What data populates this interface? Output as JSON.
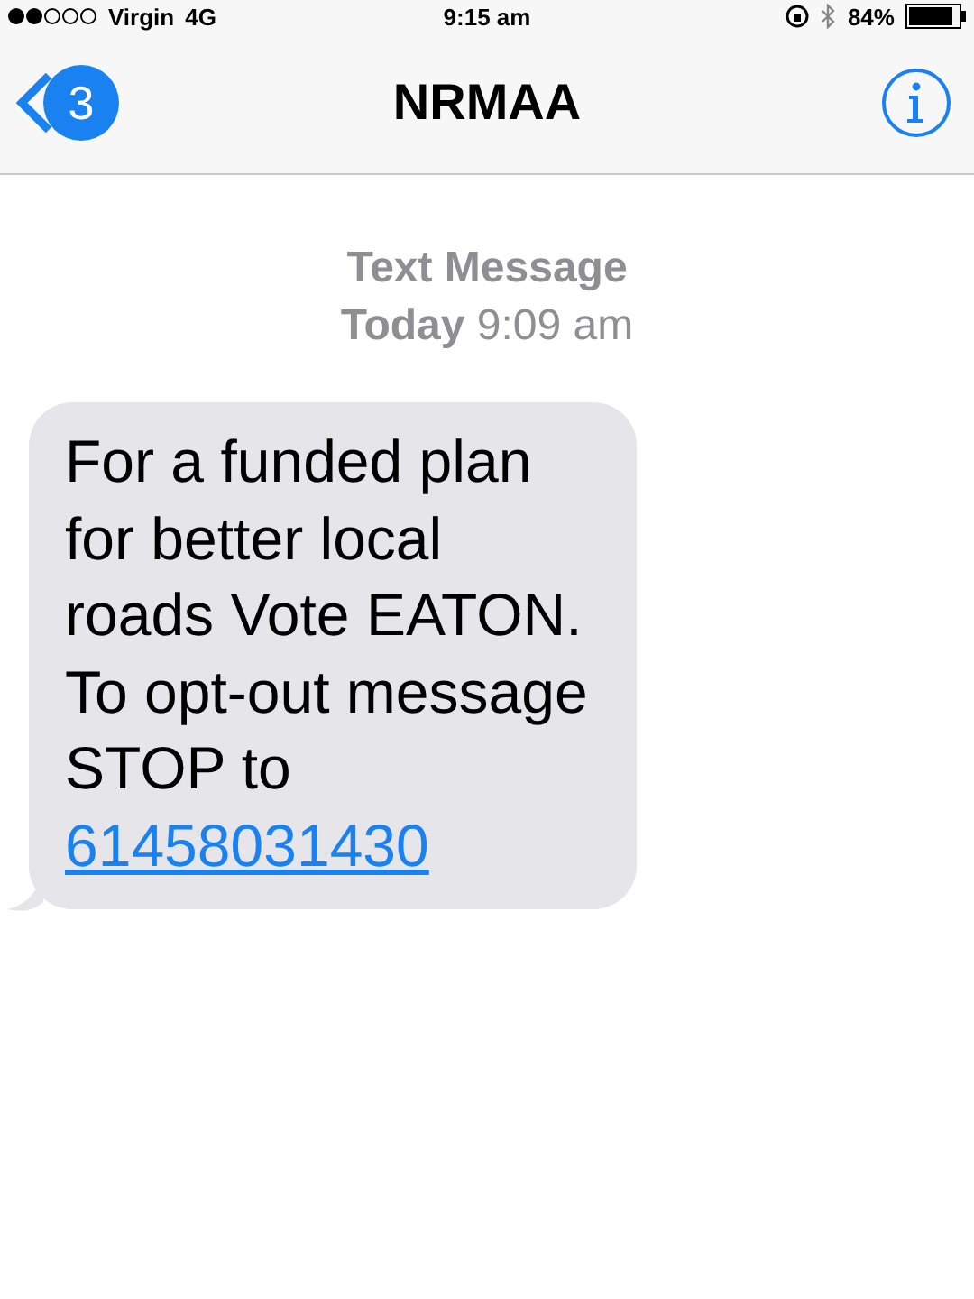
{
  "status_bar": {
    "carrier": "Virgin",
    "network": "4G",
    "time": "9:15 am",
    "battery": "84%"
  },
  "nav": {
    "back_count": "3",
    "title": "NRMAA"
  },
  "thread_header": {
    "label": "Text Message",
    "date": "**Today** 9:09 am"
  },
  "messages": [
    {
      "text": "For a funded plan for better local roads Vote EATON. To opt-out message STOP to",
      "link": "61458031430"
    }
  ]
}
